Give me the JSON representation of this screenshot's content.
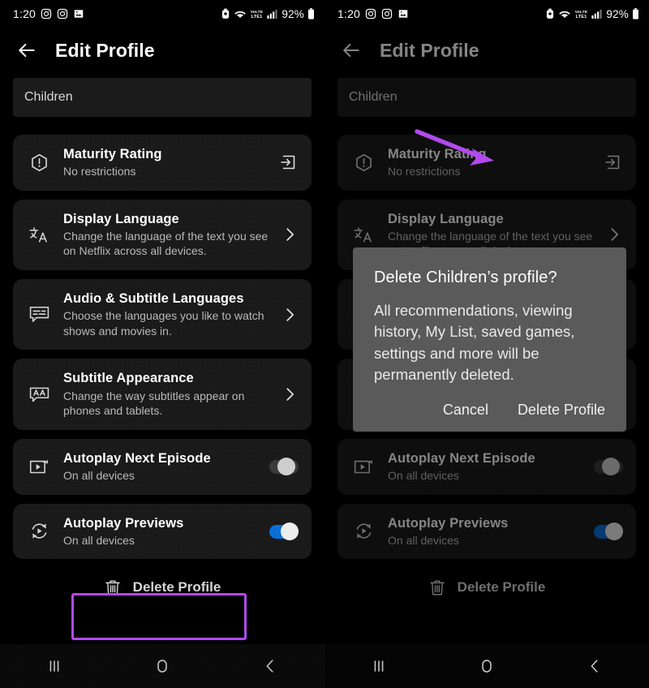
{
  "status_bar": {
    "time": "1:20",
    "left_icons": [
      "instagram-icon",
      "instagram-icon",
      "photos-icon"
    ],
    "right_icons": [
      "alarm-icon",
      "wifi-icon",
      "volte-icon",
      "signal-icon"
    ],
    "network_label": "VoLTE",
    "battery_percent": "92%"
  },
  "app_bar": {
    "back_label": "back-arrow",
    "title": "Edit Profile"
  },
  "profile": {
    "name_value": "Children"
  },
  "settings": [
    {
      "icon": "maturity-rating-icon",
      "title": "Maturity Rating",
      "subtitle": "No restrictions",
      "tail": "enter-box-arrow-icon"
    },
    {
      "icon": "translate-icon",
      "title": "Display Language",
      "subtitle": "Change the language of the text you see on Netflix across all devices.",
      "tail": "chevron-right-icon"
    },
    {
      "icon": "subtitle-bubble-icon",
      "title": "Audio & Subtitle Languages",
      "subtitle": "Choose the languages you like to watch shows and movies in.",
      "tail": "chevron-right-icon"
    },
    {
      "icon": "subtitle-appearance-icon",
      "title": "Subtitle Appearance",
      "subtitle": "Change the way subtitles appear on phones and tablets.",
      "tail": "chevron-right-icon"
    },
    {
      "icon": "autoplay-next-icon",
      "title": "Autoplay Next Episode",
      "subtitle": "On all devices",
      "tail": "toggle",
      "toggle_state": "off"
    },
    {
      "icon": "autoplay-previews-icon",
      "title": "Autoplay Previews",
      "subtitle": "On all devices",
      "tail": "toggle",
      "toggle_state": "on"
    }
  ],
  "delete_profile": {
    "label": "Delete Profile",
    "icon": "trash-icon"
  },
  "dialog": {
    "title": "Delete Children’s profile?",
    "body": "All recommendations, viewing history, My List, saved games, settings and more will be permanently deleted.",
    "cancel_label": "Cancel",
    "confirm_label": "Delete Profile"
  },
  "nav_bar": {
    "recents": "recents-icon",
    "home": "home-icon",
    "back": "back-icon"
  },
  "annotations": {
    "highlight_color": "#b14aee",
    "arrow_color": "#b14aee",
    "highlight_target": "Delete Profile",
    "arrow_target": "Delete Profile"
  }
}
